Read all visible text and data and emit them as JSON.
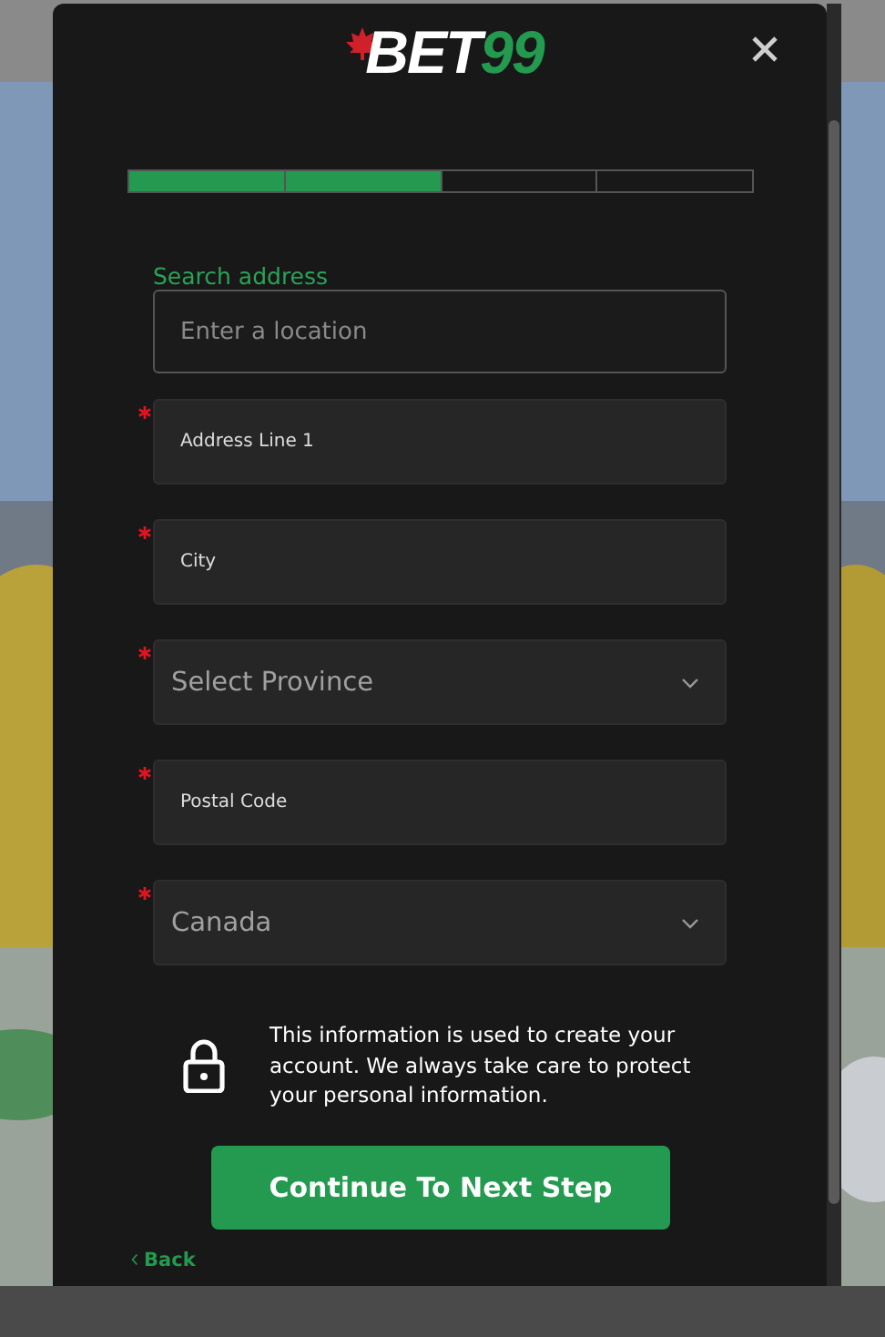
{
  "logo": {
    "word": "BET",
    "number": "99"
  },
  "progress": [
    {
      "done": true
    },
    {
      "done": true
    },
    {
      "done": false
    },
    {
      "done": false
    }
  ],
  "search": {
    "label": "Search address",
    "placeholder": "Enter a location"
  },
  "fields": [
    {
      "kind": "text",
      "label": "Address Line 1",
      "required": true
    },
    {
      "kind": "text",
      "label": "City",
      "required": true
    },
    {
      "kind": "select",
      "label": "Select Province",
      "required": true
    },
    {
      "kind": "text",
      "label": "Postal Code",
      "required": true
    },
    {
      "kind": "select",
      "label": "Canada",
      "required": true
    }
  ],
  "notice": "This information is used to create your account. We always take care to protect your personal information.",
  "continue_button": "Continue To Next Step",
  "back_link": "Back"
}
